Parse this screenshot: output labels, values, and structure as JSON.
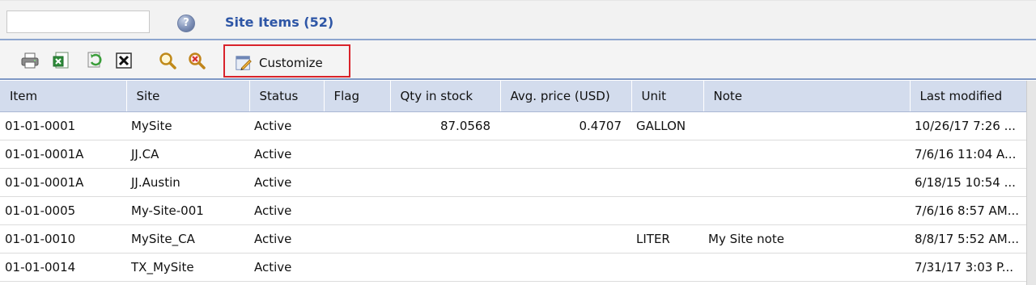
{
  "header": {
    "search_value": "",
    "help_glyph": "?",
    "title": "Site Items (52)"
  },
  "toolbar": {
    "icons": [
      "print-icon",
      "export-excel-icon",
      "refresh-icon",
      "delete-icon",
      "search-icon",
      "clear-search-icon"
    ],
    "customize_label": "Customize"
  },
  "table": {
    "columns": [
      "Item",
      "Site",
      "Status",
      "Flag",
      "Qty in stock",
      "Avg. price (USD)",
      "Unit",
      "Note",
      "Last modified"
    ],
    "rows": [
      {
        "item": "01-01-0001",
        "site": "MySite",
        "status": "Active",
        "flag": "",
        "qty": "87.0568",
        "price": "0.4707",
        "unit": "GALLON",
        "note": "",
        "modified": "10/26/17 7:26 ..."
      },
      {
        "item": "01-01-0001A",
        "site": "JJ.CA",
        "status": "Active",
        "flag": "",
        "qty": "",
        "price": "",
        "unit": "",
        "note": "",
        "modified": "7/6/16 11:04 A..."
      },
      {
        "item": "01-01-0001A",
        "site": "JJ.Austin",
        "status": "Active",
        "flag": "",
        "qty": "",
        "price": "",
        "unit": "",
        "note": "",
        "modified": "6/18/15 10:54 ..."
      },
      {
        "item": "01-01-0005",
        "site": "My-Site-001",
        "status": "Active",
        "flag": "",
        "qty": "",
        "price": "",
        "unit": "",
        "note": "",
        "modified": "7/6/16 8:57 AM..."
      },
      {
        "item": "01-01-0010",
        "site": "MySite_CA",
        "status": "Active",
        "flag": "",
        "qty": "",
        "price": "",
        "unit": "LITER",
        "note": "My Site note",
        "modified": "8/8/17 5:52 AM..."
      },
      {
        "item": "01-01-0014",
        "site": "TX_MySite",
        "status": "Active",
        "flag": "",
        "qty": "",
        "price": "",
        "unit": "",
        "note": "",
        "modified": "7/31/17 3:03 P..."
      }
    ]
  }
}
